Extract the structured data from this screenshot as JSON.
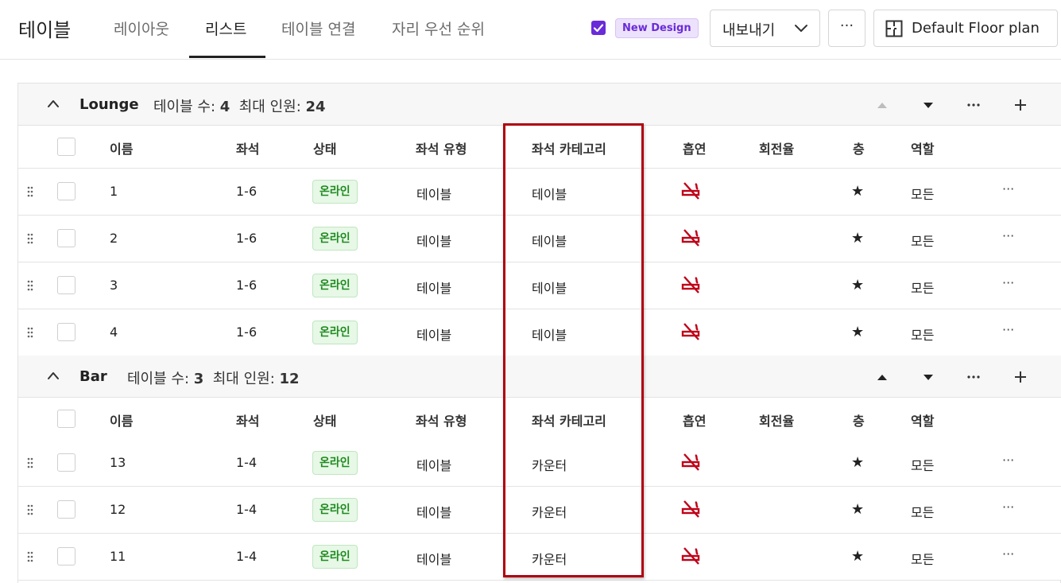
{
  "app": {
    "title": "테이블"
  },
  "tabs": [
    {
      "label": "레이아웃"
    },
    {
      "label": "리스트"
    },
    {
      "label": "테이블 연결"
    },
    {
      "label": "자리 우선 순위"
    }
  ],
  "toolbar": {
    "new_design_label": "New Design",
    "export_label": "내보내기",
    "more_label": "···",
    "floor_plan_label": "Default Floor plan"
  },
  "columns": {
    "name": "이름",
    "seats": "좌석",
    "status": "상태",
    "seat_type": "좌석 유형",
    "seat_category": "좌석 카테고리",
    "smoking": "흡연",
    "turnover": "회전율",
    "floor": "층",
    "role": "역할"
  },
  "groups": [
    {
      "name": "Lounge",
      "stats_label_tables": "테이블 수:",
      "table_count": "4",
      "stats_label_max": "최대 인원:",
      "max_guests": "24",
      "rows": [
        {
          "name": "1",
          "seats": "1-6",
          "status": "온라인",
          "seat_type": "테이블",
          "seat_category": "테이블",
          "floor": "★",
          "role": "모든"
        },
        {
          "name": "2",
          "seats": "1-6",
          "status": "온라인",
          "seat_type": "테이블",
          "seat_category": "테이블",
          "floor": "★",
          "role": "모든"
        },
        {
          "name": "3",
          "seats": "1-6",
          "status": "온라인",
          "seat_type": "테이블",
          "seat_category": "테이블",
          "floor": "★",
          "role": "모든"
        },
        {
          "name": "4",
          "seats": "1-6",
          "status": "온라인",
          "seat_type": "테이블",
          "seat_category": "테이블",
          "floor": "★",
          "role": "모든"
        }
      ]
    },
    {
      "name": "Bar",
      "stats_label_tables": "테이블 수:",
      "table_count": "3",
      "stats_label_max": "최대 인원:",
      "max_guests": "12",
      "rows": [
        {
          "name": "13",
          "seats": "1-4",
          "status": "온라인",
          "seat_type": "테이블",
          "seat_category": "카운터",
          "floor": "★",
          "role": "모든"
        },
        {
          "name": "12",
          "seats": "1-4",
          "status": "온라인",
          "seat_type": "테이블",
          "seat_category": "카운터",
          "floor": "★",
          "role": "모든"
        },
        {
          "name": "11",
          "seats": "1-4",
          "status": "온라인",
          "seat_type": "테이블",
          "seat_category": "카운터",
          "floor": "★",
          "role": "모든"
        }
      ]
    }
  ],
  "row_more_label": "···",
  "colors": {
    "accent": "#6a2bd9",
    "online": "#1f8a1f",
    "smoking_icon": "#c00018",
    "highlight": "#b00010"
  }
}
